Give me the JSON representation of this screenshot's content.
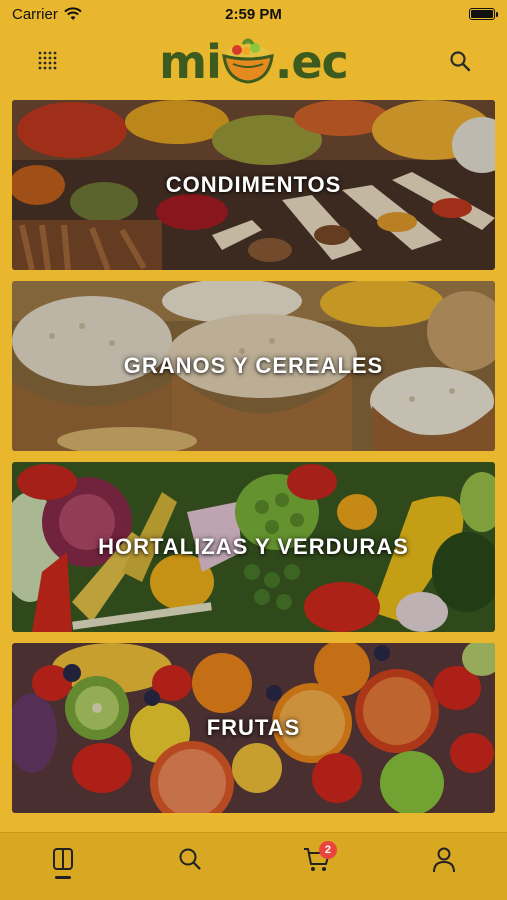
{
  "status_bar": {
    "carrier": "Carrier",
    "time": "2:59 PM"
  },
  "header": {
    "logo_text_left": "mi",
    "logo_text_right": ".ec",
    "menu_icon": "grid-dots-icon",
    "search_icon": "search-icon"
  },
  "categories": [
    {
      "label": "CONDIMENTOS",
      "theme": "spices"
    },
    {
      "label": "GRANOS Y CEREALES",
      "theme": "grains"
    },
    {
      "label": "HORTALIZAS Y VERDURAS",
      "theme": "vegetables"
    },
    {
      "label": "FRUTAS",
      "theme": "fruits"
    }
  ],
  "tab_bar": {
    "tabs": [
      {
        "icon": "book-icon",
        "active": true
      },
      {
        "icon": "search-icon",
        "active": false
      },
      {
        "icon": "cart-icon",
        "active": false,
        "badge": "2"
      },
      {
        "icon": "user-icon",
        "active": false
      }
    ]
  },
  "colors": {
    "background": "#e8b72e",
    "logo_green": "#3d5a1f",
    "logo_orange": "#e58a1f",
    "badge_red": "#e8453c"
  }
}
